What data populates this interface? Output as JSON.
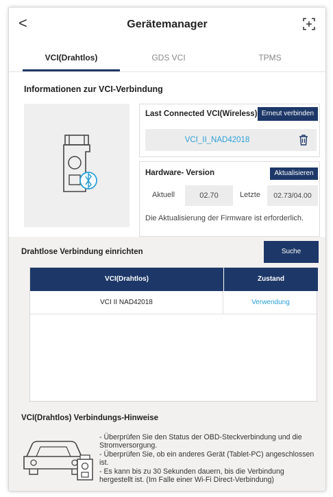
{
  "header": {
    "back_glyph": "<",
    "title": "Gerätemanager",
    "expand_icon": "expand-icon"
  },
  "tabs": [
    {
      "label": "VCI(Drahtlos)",
      "active": true
    },
    {
      "label": "GDS VCI",
      "active": false
    },
    {
      "label": "TPMS",
      "active": false
    }
  ],
  "info": {
    "title": "Informationen zur VCI-Verbindung",
    "last_connected_label": "Last Connected VCI(Wireless)",
    "reconnect_button": "Erneut verbinden",
    "device_name": "VCI_II_NAD42018",
    "hardware_label": "Hardware- Version",
    "update_button": "Aktualisieren",
    "current_label": "Aktuell",
    "current_value": "02.70",
    "latest_label": "Letzte",
    "latest_value": "02.73/04.00",
    "firmware_notice": "Die Aktualisierung der Firmware ist erforderlich."
  },
  "wireless": {
    "title": "Drahtlose Verbindung einrichten",
    "search_button": "Suche",
    "columns": [
      "VCI(Drahtlos)",
      "Zustand"
    ],
    "rows": [
      {
        "vci": "VCI II NAD42018",
        "status": "Verwendung"
      }
    ]
  },
  "hints": {
    "title": "VCI(Drahtlos) Verbindungs-Hinweise",
    "lines": [
      "- Überprüfen Sie den Status der OBD-Steckverbindung und die Stromversorgung.",
      "- Überprüfen Sie, ob ein anderes Gerät (Tablet-PC) angeschlossen ist.",
      "- Es kann bis zu 30 Sekunden dauern, bis die Verbindung hergestellt ist. (Im Falle einer Wi-Fi Direct-Verbindung)"
    ]
  },
  "colors": {
    "navy": "#1d3868",
    "accent_link": "#2a9fd6",
    "panel_grey": "#efefef"
  }
}
